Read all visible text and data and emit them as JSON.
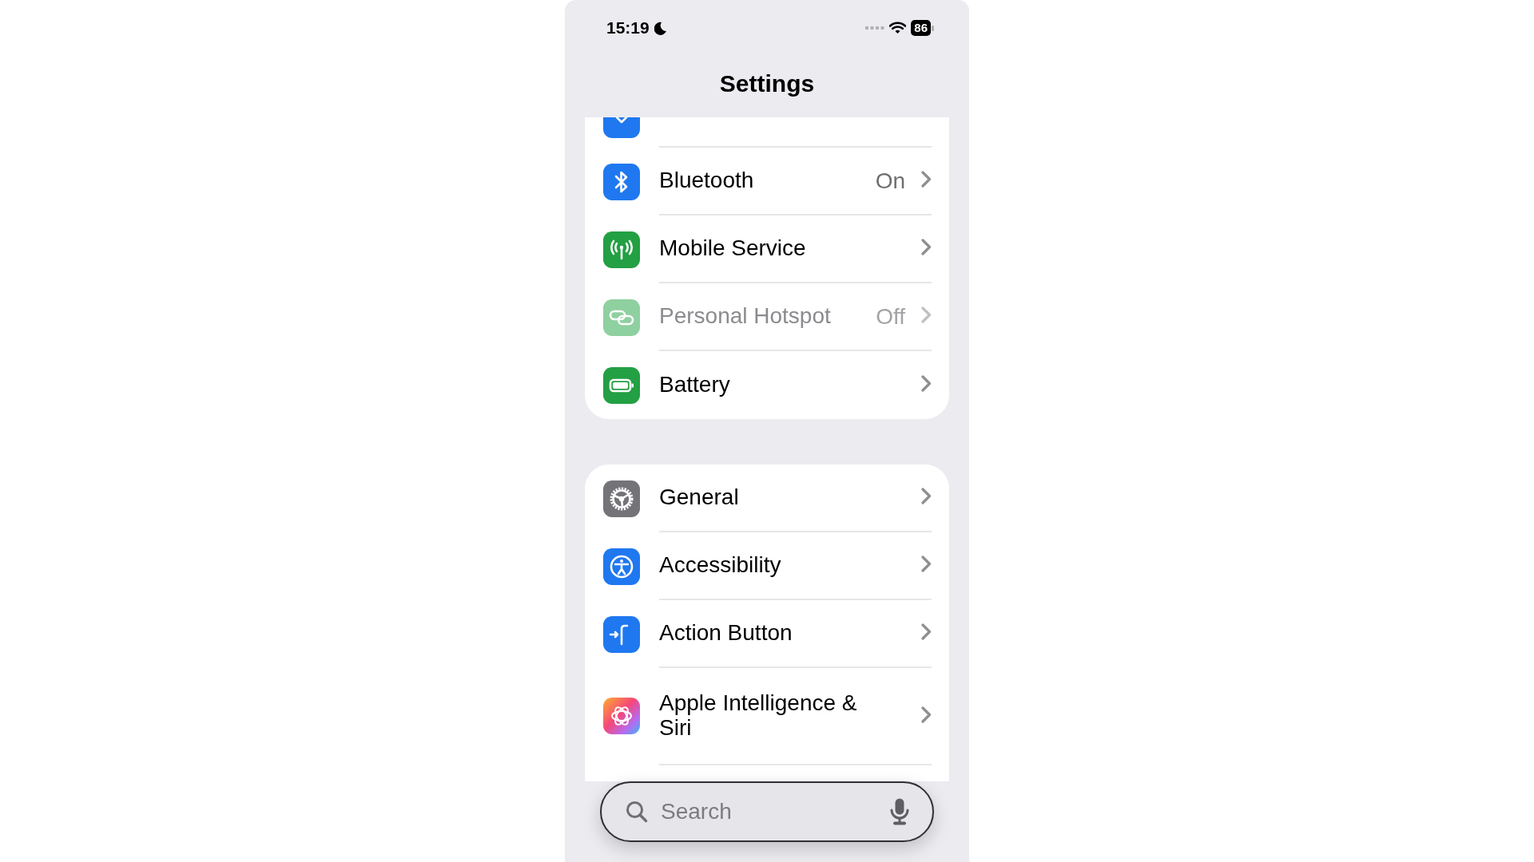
{
  "status_bar": {
    "time": "15:19",
    "battery": "86"
  },
  "title": "Settings",
  "groups": [
    {
      "cut_off_top": true,
      "rows": [
        {
          "label": "Bluetooth",
          "value": "On",
          "disabled": false
        },
        {
          "label": "Mobile Service",
          "disabled": false
        },
        {
          "label": "Personal Hotspot",
          "value": "Off",
          "disabled": true
        },
        {
          "label": "Battery",
          "disabled": false
        }
      ]
    },
    {
      "cut_off_top": false,
      "rows": [
        {
          "label": "General",
          "disabled": false
        },
        {
          "label": "Accessibility",
          "disabled": false
        },
        {
          "label": "Action Button",
          "disabled": false
        },
        {
          "label": "Apple Intelligence & Siri",
          "disabled": false
        }
      ]
    }
  ],
  "search": {
    "placeholder": "Search"
  }
}
